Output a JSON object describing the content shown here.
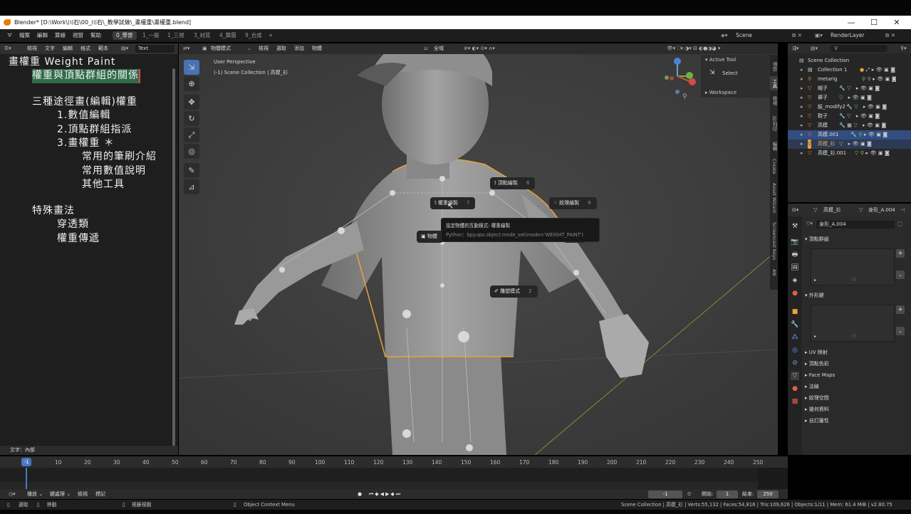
{
  "window": {
    "title": "Blender* [D:\\Work\\川石\\00_川石\\_教學試做\\_畫權重\\畫權重.blend]",
    "minimize": "—",
    "maximize": "☐",
    "close": "✕"
  },
  "menu": {
    "items": [
      "檔案",
      "編輯",
      "算繪",
      "視窗",
      "幫助"
    ],
    "workspaces": [
      "0_學習",
      "1_一般",
      "1_三視",
      "3_材質",
      "4_算圖",
      "9_合成",
      "+"
    ],
    "active_workspace": "0_學習",
    "scene": "Scene",
    "view_layer": "RenderLayer"
  },
  "text_editor": {
    "menu": [
      "檢視",
      "文字",
      "編輯",
      "格式",
      "範本"
    ],
    "file": "Text",
    "footer": "文字：內部",
    "lines": [
      "畫權重 Weight Paint",
      "權重與頂點群組的關係",
      "三種途徑畫(編輯)權重",
      "1.數值編輯",
      "2.頂點群組指派",
      "3.畫權重 ＊",
      "常用的筆刷介紹",
      "常用數值說明",
      "其他工具",
      "特殊畫法",
      "穿透類",
      "權重傳遞"
    ]
  },
  "viewport": {
    "mode": "物體模式",
    "menu": [
      "檢視",
      "選取",
      "添加",
      "物體"
    ],
    "orientation": "全域",
    "perspective": "User Perspective",
    "collection": "(-1) Scene Collection | 高模_衫",
    "pie": [
      {
        "label": "頂點繪製",
        "key": "8"
      },
      {
        "label": "權重繪製",
        "key": "7"
      },
      {
        "label": "紋理繪製",
        "key": "9"
      },
      {
        "label": "物體",
        "key": ""
      },
      {
        "label": "6",
        "key": ""
      },
      {
        "label": "雕塑模式",
        "key": "2"
      }
    ],
    "tooltip": {
      "title": "設定物體的互動模式: 權重繪製",
      "python": "Python：bpy.ops.object.mode_set(mode='WEIGHT_PAINT')"
    },
    "active_tool": {
      "header": "Active Tool",
      "tool": "Select",
      "workspace": "Workspace"
    },
    "tabs": [
      "項目",
      "工具",
      "檢視",
      "3D列印",
      "編輯",
      "Create",
      "Asset Wizard",
      "Screencast Keys",
      "AN"
    ]
  },
  "outliner": {
    "search": "",
    "rows": [
      {
        "name": "Scene Collection",
        "indent": 0
      },
      {
        "name": "Collection 1",
        "indent": 1
      },
      {
        "name": "metarig",
        "indent": 1
      },
      {
        "name": "帽子",
        "indent": 1
      },
      {
        "name": "褲子",
        "indent": 1
      },
      {
        "name": "臉_modify2",
        "indent": 1
      },
      {
        "name": "鞋子",
        "indent": 1
      },
      {
        "name": "高模",
        "indent": 1
      },
      {
        "name": "高模.001",
        "indent": 1,
        "selected": true
      },
      {
        "name": "高模_衫",
        "indent": 1,
        "active": true
      },
      {
        "name": "高模_衫.001",
        "indent": 1
      }
    ]
  },
  "properties": {
    "object": "高模_衫",
    "mesh": "身形_A.004",
    "mesh_field": "身形_A.004",
    "sections": [
      "頂點群組",
      "外形鍵",
      "UV 映射",
      "頂點色彩",
      "Face Maps",
      "法線",
      "紋理空間",
      "幾何資料",
      "自訂屬性"
    ]
  },
  "timeline": {
    "current_frame": "-1",
    "ticks": [
      "10",
      "20",
      "30",
      "40",
      "50",
      "60",
      "70",
      "80",
      "90",
      "100",
      "110",
      "120",
      "130",
      "140",
      "150",
      "160",
      "170",
      "180",
      "190",
      "200",
      "210",
      "220",
      "230",
      "240",
      "250"
    ],
    "controls": [
      "播放",
      "鍵處理",
      "檢視",
      "標記"
    ],
    "frame_field": "-1",
    "start_label": "開始:",
    "start": "1",
    "end_label": "結束:",
    "end": "250"
  },
  "statusbar": {
    "left": [
      "選取",
      "移動",
      "搖鏡視圖",
      "Object Context Menu"
    ],
    "right": "Scene Collection | 高模_衫 | Verts:55,132 | Faces:54,816 | Tris:109,626 | Objects:1/11 | Mem: 61.4 MiB | v2.80.75"
  },
  "colors": {
    "accent": "#4772b3",
    "selection": "#e8a33a",
    "highlight_text_bg": "#2f6b4a"
  }
}
